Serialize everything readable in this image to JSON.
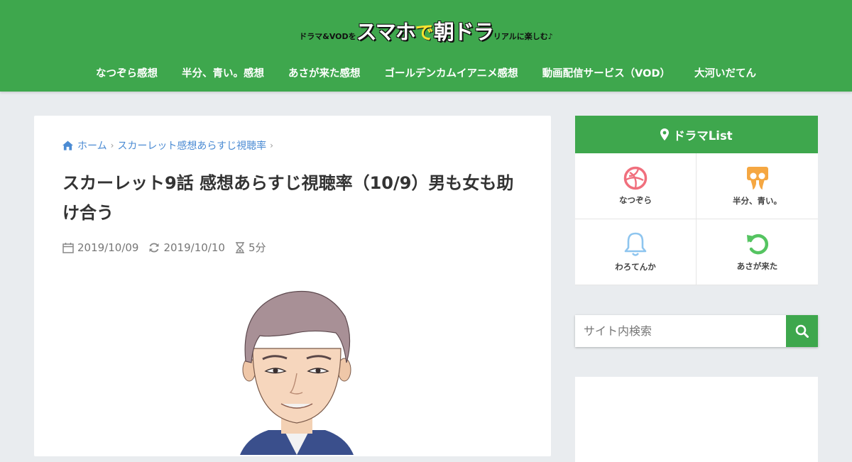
{
  "header": {
    "logo": {
      "part1": "ドラマ&VODを",
      "part2": "スマホ",
      "part3": "で",
      "part4": "朝ドラ",
      "part5": "リアルに楽しむ♪"
    },
    "nav": [
      "なつぞら感想",
      "半分、青い。感想",
      "あさが来た感想",
      "ゴールデンカムイアニメ感想",
      "動画配信サービス（VOD）",
      "大河いだてん"
    ]
  },
  "breadcrumb": {
    "home": "ホーム",
    "category": "スカーレット感想あらすじ視聴率"
  },
  "article": {
    "title": "スカーレット9話 感想あらすじ視聴率（10/9）男も女も助け合う",
    "published": "2019/10/09",
    "updated": "2019/10/10",
    "read_time": "5分"
  },
  "sidebar": {
    "widget_title": "ドラマList",
    "items": [
      {
        "label": "なつぞら",
        "icon": "dribbble-icon",
        "color": "#f06f7d"
      },
      {
        "label": "半分、青い。",
        "icon": "slideshare-icon",
        "color": "#f5a742"
      },
      {
        "label": "わろてんか",
        "icon": "bell-icon",
        "color": "#8ec5ef"
      },
      {
        "label": "あさが来た",
        "icon": "undo-icon",
        "color": "#55c461"
      }
    ]
  },
  "search": {
    "placeholder": "サイト内検索"
  },
  "colors": {
    "brand_green": "#3ea74d",
    "link_blue": "#4b8bd3",
    "background": "#e9ecef"
  }
}
